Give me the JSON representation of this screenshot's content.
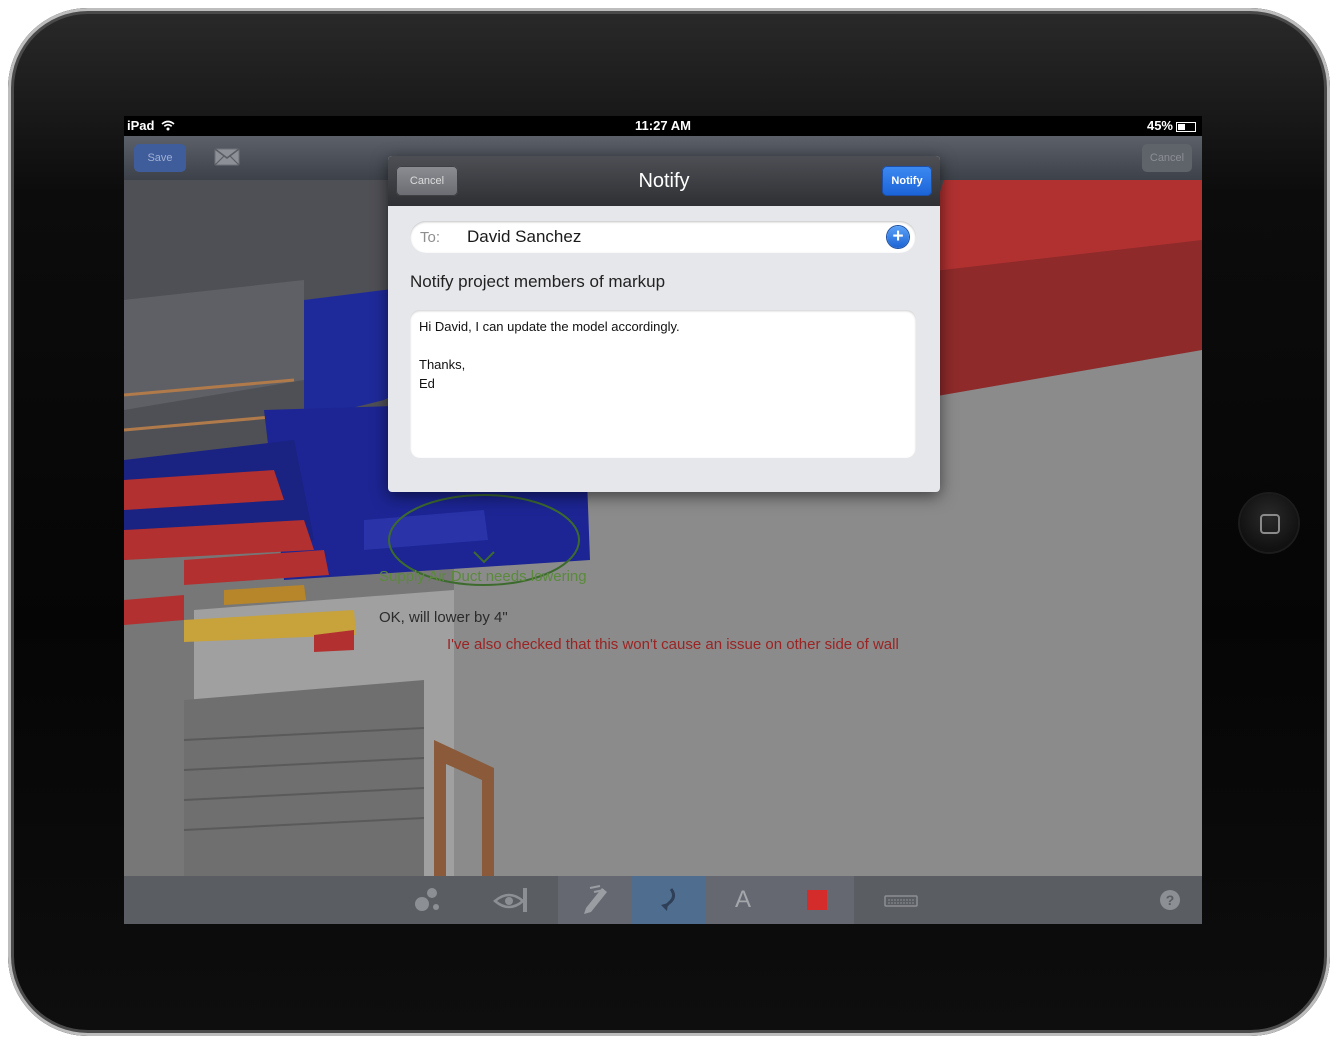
{
  "device": {
    "model": "iPad"
  },
  "status_bar": {
    "carrier": "iPad",
    "time": "11:27 AM",
    "battery": "45%"
  },
  "nav_bar": {
    "save_label": "Save",
    "cancel_label": "Cancel"
  },
  "annotations": {
    "green_note": "Supply Air Duct needs lowering",
    "reply_note": "OK, will lower by 4\"",
    "red_note": "I've also checked that this won't cause an issue on other side of wall"
  },
  "notify_dialog": {
    "title": "Notify",
    "cancel_label": "Cancel",
    "notify_label": "Notify",
    "to_label": "To:",
    "to_value": "David Sanchez",
    "add_icon_glyph": "+",
    "subject": "Notify project members of markup",
    "message_lines": [
      "Hi David, I can update the model accordingly.",
      "",
      "Thanks,",
      "Ed"
    ]
  },
  "toolbar": {
    "tools": [
      "cloud-shapes-icon",
      "eye-camera-icon",
      "pencil-icon",
      "arrow-icon",
      "text-icon",
      "color-swatch-icon",
      "keyboard-icon"
    ],
    "text_tool_glyph": "A",
    "help_glyph": "?",
    "active_tool": "arrow-icon",
    "color_swatch": "#d42b2b"
  },
  "colors": {
    "accent_blue": "#1a63d8",
    "markup_red": "#9b2323",
    "markup_green": "#5a8a3a"
  }
}
